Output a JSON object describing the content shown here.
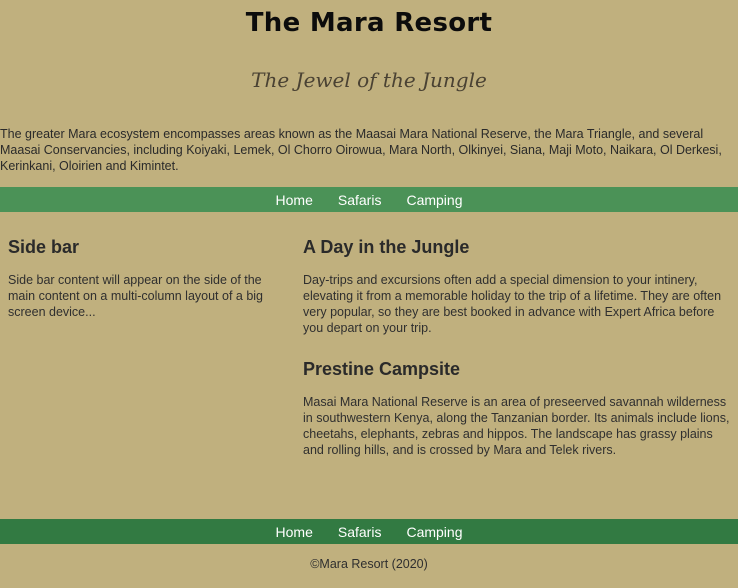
{
  "header": {
    "title": "The Mara Resort",
    "tagline": "The Jewel of the Jungle",
    "intro": "The greater Mara ecosystem encompasses areas known as the Maasai Mara National Reserve, the Mara Triangle, and several Maasai Conservancies, including Koiyaki, Lemek, Ol Chorro Oirowua, Mara North, Olkinyei, Siana, Maji Moto, Naikara, Ol Derkesi, Kerinkani, Oloirien and Kimintet."
  },
  "nav": {
    "items": [
      "Home",
      "Safaris",
      "Camping"
    ]
  },
  "sidebar": {
    "heading": "Side bar",
    "text": "Side bar content will appear on the side of the main content on a multi-column layout of a big screen device..."
  },
  "main": {
    "articles": [
      {
        "heading": "A Day in the Jungle",
        "text": "Day-trips and excursions often add a special dimension to your intinery, elevating it from a memorable holiday to the trip of a lifetime. They are often very popular, so they are best booked in advance with Expert Africa before you depart on your trip."
      },
      {
        "heading": "Prestine Campsite",
        "text": "Masai Mara National Reserve is an area of preseerved savannah wilderness in southwestern Kenya, along the Tanzanian border. Its animals include lions, cheetahs, elephants, zebras and hippos. The landscape has grassy plains and rolling hills, and is crossed by Mara and Telek rivers."
      }
    ]
  },
  "footer": {
    "nav_items": [
      "Home",
      "Safaris",
      "Camping"
    ],
    "copyright": "©Mara Resort (2020)"
  },
  "colors": {
    "page_background": "#c0b07e",
    "top_nav_background": "#4b9257",
    "bottom_nav_background": "#327a42",
    "nav_text": "#ffffff"
  }
}
